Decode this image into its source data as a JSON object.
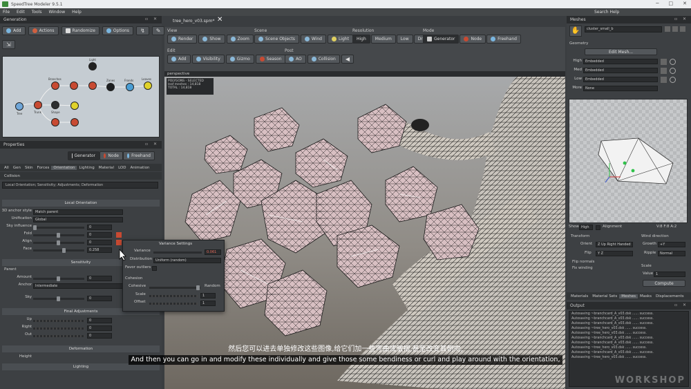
{
  "title_bar": {
    "title": "SpeedTree Modeler 9.5.1"
  },
  "menu": {
    "items": [
      "File",
      "Edit",
      "Tools",
      "Window",
      "Help"
    ],
    "search_help": "Search Help"
  },
  "generation_panel": {
    "title": "Generation",
    "buttons": [
      "Add",
      "Actions",
      "Randomize",
      "Options"
    ],
    "nodes": [
      "Tree",
      "Trunk",
      "Branches",
      "Leaves",
      "Fronds",
      "Zones",
      "Light",
      "Shape"
    ]
  },
  "properties_panel": {
    "title": "Properties",
    "mode_tabs": [
      "Generator",
      "Node",
      "Freehand"
    ],
    "tabs": [
      "All",
      "Gen",
      "Skin",
      "Forces",
      "Orientation",
      "Lighting",
      "Material",
      "LOD",
      "Animation"
    ],
    "tab_collision": "Collision",
    "search_value": "Local Orientation; Sensitivity; Adjustments; Deformation",
    "local_orientation": {
      "header": "Local Orientation",
      "anchor_style_label": "3D anchor style",
      "anchor_style_value": "Match parent",
      "unification_label": "Unification",
      "unification_value": "Global",
      "sky_influence_label": "Sky influence",
      "fold_label": "Fold",
      "align_label": "Align",
      "face_label": "Face",
      "face_value": "0.258",
      "sky_value": "0",
      "fold_value": "0",
      "align_value": "0"
    },
    "sensitivity": {
      "header": "Sensitivity",
      "parent_label": "Parent",
      "amount_label": "Amount",
      "amount_value": "0",
      "anchor_label": "Anchor",
      "anchor_value": "Intermediate",
      "sky_label": "Sky",
      "sky_value": "0"
    },
    "final_adjustments": {
      "header": "Final Adjustments",
      "up_label": "Up",
      "right_label": "Right",
      "out_label": "Out",
      "up_value": "0",
      "right_value": "0",
      "out_value": "0"
    },
    "deformation": {
      "header": "Deformation",
      "height_label": "Height",
      "lighting_label": "Lighting"
    }
  },
  "variance_dialog": {
    "title": "Variance Settings",
    "variance_label": "Variance",
    "variance_value": "0.061",
    "distribution_label": "Distribution",
    "distribution_value": "Uniform (random)",
    "favor_outliers_label": "Favor outliers",
    "cohesion_label": "Cohesion",
    "cohesive_label": "Cohesive",
    "random_label": "Random",
    "scale_label": "Scale",
    "offset_label": "Offset",
    "scale_value": "1",
    "offset_value": "1"
  },
  "document": {
    "tab_name": "tree_hero_v03.spm*",
    "close": "✕"
  },
  "toolbar": {
    "view_label": "View",
    "view_buttons": [
      "Render",
      "Show",
      "Zoom"
    ],
    "scene_label": "Scene",
    "scene_buttons": [
      "Scene Objects",
      "Wind",
      "Light"
    ],
    "resolution_label": "Resolution",
    "resolution_buttons": [
      "High",
      "Medium",
      "Low",
      "Draft"
    ],
    "mode_label": "Mode",
    "mode_buttons": [
      "Generator",
      "Node",
      "Freehand"
    ],
    "edit_label": "Edit",
    "edit_buttons": [
      "Add",
      "Visibility",
      "Gizmo",
      "Season"
    ],
    "post_label": "Post",
    "post_buttons": [
      "AO",
      "Collision"
    ]
  },
  "viewport": {
    "label": "perspective",
    "stats_title": "POLYGONS - SELECTED",
    "stats_leaf": "leaf meshes : 14,818",
    "stats_total": "TOTAL : 14,818"
  },
  "meshes_panel": {
    "title": "Meshes",
    "mesh_name": "cluster_small_b",
    "geometry_label": "Geometry",
    "edit_mesh_button": "Edit Mesh...",
    "lods": [
      {
        "label": "High",
        "value": "Embedded"
      },
      {
        "label": "Med",
        "value": "Embedded"
      },
      {
        "label": "Low",
        "value": "Embedded"
      },
      {
        "label": "More",
        "value": "None"
      }
    ],
    "show_label": "Show",
    "show_value": "High",
    "alignment_label": "Alignment",
    "vert_count": "V:8 F:8 A:2",
    "transform_label": "Transform",
    "orient_label": "Orient",
    "orient_value": "Z Up Right Handed",
    "flip_label": "Flip",
    "flip_value": "Y Z",
    "flip_normals": "Flip normals",
    "fix_winding": "Fix winding",
    "wind_direction_label": "Wind direction",
    "growth_label": "Growth",
    "growth_value": "+Y",
    "ripple_label": "Ripple",
    "ripple_value": "Normal",
    "scale_label": "Scale",
    "value_label": "Value",
    "value_value": "1",
    "compute_button": "Compute",
    "bottom_tabs": [
      "Materials",
      "Material Sets",
      "Meshes",
      "Masks",
      "Displacements"
    ]
  },
  "output_panel": {
    "title": "Output",
    "lines": [
      "Autosaving ~branchcard_A_v03.dsk ...... success.",
      "Autosaving ~branchcard_A_v03.dsk ...... success.",
      "Autosaving ~branchcard_A_v03.dsk ...... success.",
      "Autosaving ~tree_hero_v03.dsk ...... success.",
      "Autosaving ~tree_hero_v03.dsk ...... success.",
      "Autosaving ~branchcard_A_v03.dsk ...... success.",
      "Autosaving ~branchcard_A_v03.dsk ...... success.",
      "Autosaving ~tree_hero_v03.dsk ...... success.",
      "Autosaving ~branchcard_A_v03.dsk ...... success.",
      "Autosaving ~tree_hero_v03.dsk ...... success."
    ]
  },
  "subtitles": {
    "chinese": "然后您可以进去单独修改这些图像,给它们加一些弯曲或皱褶,甚至改变其朝向,",
    "english": "And then you can go in and modify these individually and give those some bendiness or curl and play around with the orientation,"
  },
  "watermark": "WORKSHOP"
}
